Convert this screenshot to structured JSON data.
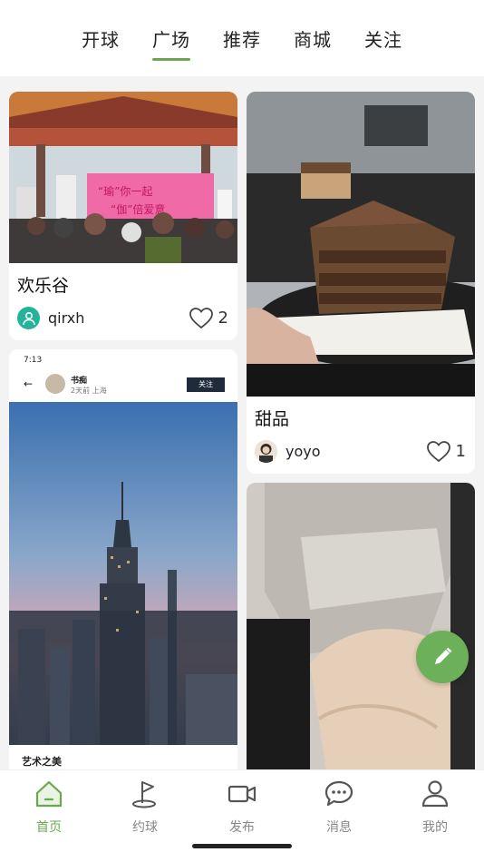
{
  "tabs": [
    {
      "label": "开球"
    },
    {
      "label": "广场"
    },
    {
      "label": "推荐"
    },
    {
      "label": "商城"
    },
    {
      "label": "关注"
    }
  ],
  "active_tab": "广场",
  "cards": [
    {
      "title": "欢乐谷",
      "user": "qirxh",
      "likes": "2"
    },
    {
      "title": "甜品",
      "user": "yoyo",
      "likes": "1"
    },
    {
      "inner_status_time": "7:13",
      "inner_author": "书痴",
      "inner_author_meta": "2天前 上海",
      "inner_follow": "关注",
      "inner_caption": "艺术之美"
    },
    {}
  ],
  "banner_text": [
    "“瑜”你一起",
    "“伽”倍爱意"
  ],
  "nav": [
    {
      "label": "首页",
      "icon": "home-icon"
    },
    {
      "label": "约球",
      "icon": "golf-flag-icon"
    },
    {
      "label": "发布",
      "icon": "video-camera-icon"
    },
    {
      "label": "消息",
      "icon": "chat-bubble-icon"
    },
    {
      "label": "我的",
      "icon": "user-icon"
    }
  ],
  "colors": {
    "accent": "#6aa84f",
    "fab": "#6cb05a",
    "avatar_teal": "#22b39a"
  }
}
